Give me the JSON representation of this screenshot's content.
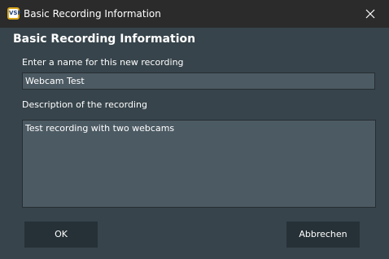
{
  "window": {
    "title": "Basic Recording Information",
    "app_icon_text": "VSF",
    "icons": {
      "app": "vsf-app-icon",
      "close": "close-icon"
    }
  },
  "dialog": {
    "heading": "Basic Recording Information",
    "name_label": "Enter a name for this new recording",
    "name_value": "Webcam Test",
    "description_label": "Description of the recording",
    "description_value": "Test recording with two webcams"
  },
  "buttons": {
    "ok_label": "OK",
    "cancel_label": "Abbrechen"
  },
  "colors": {
    "background": "#37444b",
    "titlebar": "#2b2b2b",
    "input_background": "#4c5a63",
    "button_background": "#263137",
    "text": "#ffffff"
  }
}
